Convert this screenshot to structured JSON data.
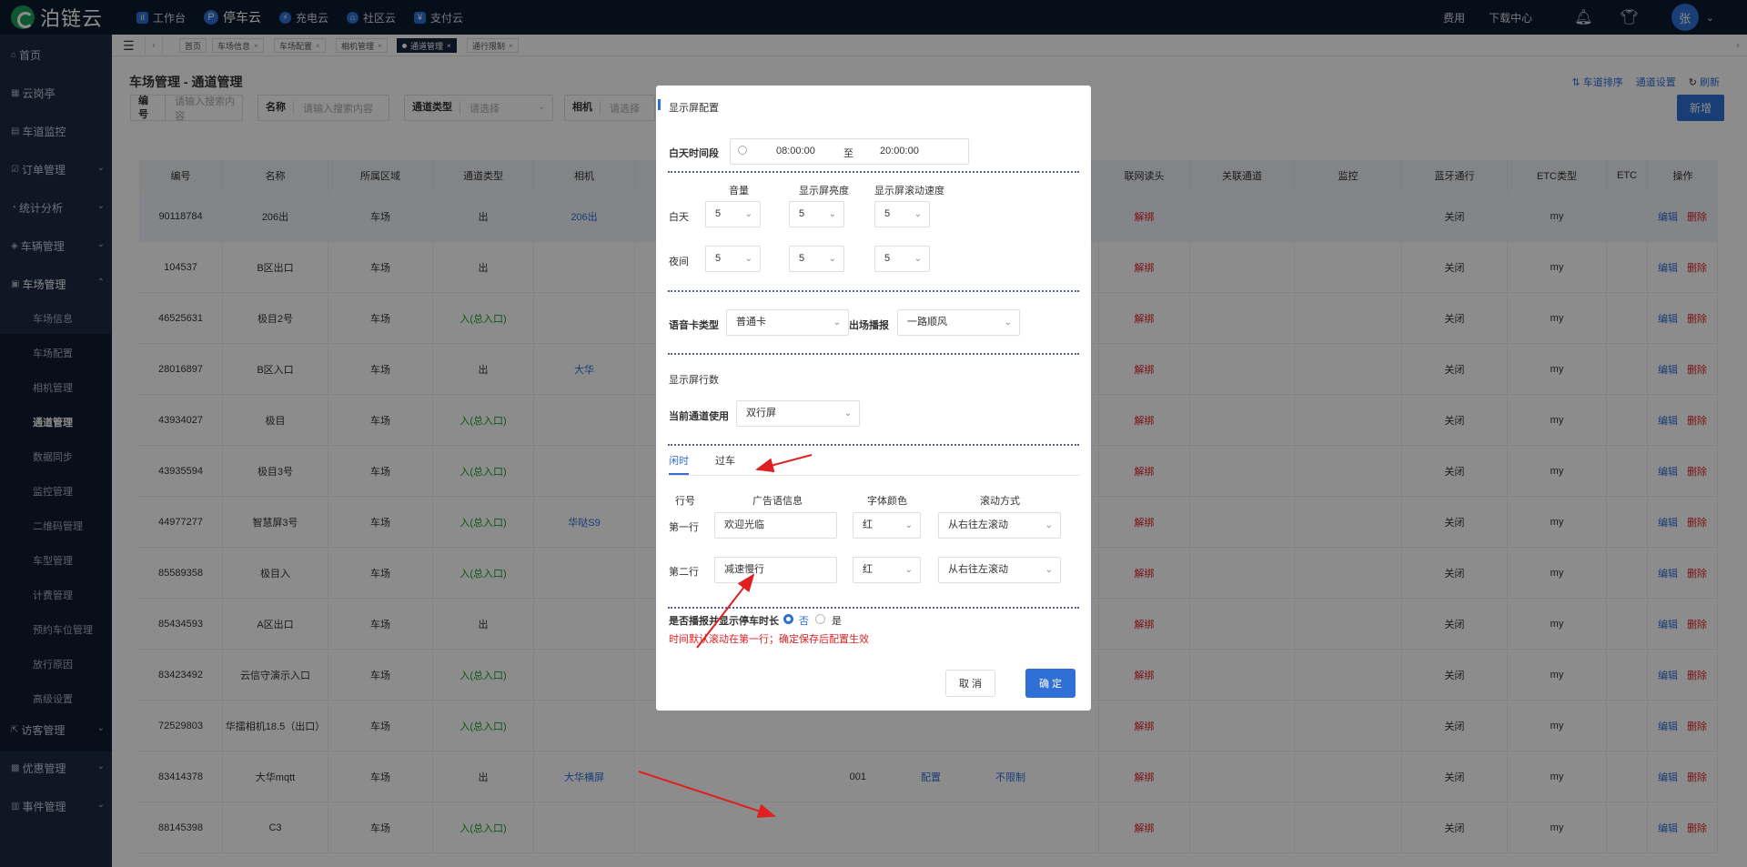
{
  "topbar": {
    "logo_text": "泊链云",
    "nav": [
      {
        "label": "工作台",
        "icon": "dashboard-icon"
      },
      {
        "label": "停车云",
        "icon": "parking-icon"
      },
      {
        "label": "充电云",
        "icon": "charging-icon"
      },
      {
        "label": "社区云",
        "icon": "community-icon"
      },
      {
        "label": "支付云",
        "icon": "payment-icon"
      }
    ],
    "fees": "费用",
    "download": "下载中心",
    "avatar": "张"
  },
  "sidebar": {
    "items": [
      {
        "label": "首页"
      },
      {
        "label": "云岗亭"
      },
      {
        "label": "车道监控"
      },
      {
        "label": "订单管理"
      },
      {
        "label": "统计分析"
      },
      {
        "label": "车辆管理"
      },
      {
        "label": "车场管理"
      },
      {
        "label": "访客管理"
      },
      {
        "label": "优惠管理"
      },
      {
        "label": "事件管理"
      }
    ],
    "sub_items": [
      "车场信息",
      "车场配置",
      "相机管理",
      "通道管理",
      "数据同步",
      "监控管理",
      "二维码管理",
      "车型管理",
      "计费管理",
      "预约车位管理",
      "放行原因",
      "高级设置"
    ]
  },
  "tabs": [
    "首页",
    "车场信息",
    "车场配置",
    "相机管理",
    "通道管理",
    "通行限制"
  ],
  "page": {
    "title": "车场管理 - 通道管理",
    "links": {
      "sort": "车道排序",
      "settings": "通道设置",
      "refresh": "刷新"
    },
    "filters": [
      {
        "label": "编号",
        "placeholder": "请输入搜索内容"
      },
      {
        "label": "名称",
        "placeholder": "请输入搜索内容"
      },
      {
        "label": "通道类型",
        "placeholder": "请选择"
      },
      {
        "label": "相机",
        "placeholder": "请选择"
      }
    ],
    "new_button": "新增"
  },
  "table": {
    "headers": [
      "编号",
      "名称",
      "所属区域",
      "通道类型",
      "相机",
      "联网读头",
      "关联通道",
      "监控",
      "蓝牙通行",
      "ETC类型",
      "ETC",
      "操作"
    ],
    "rows": [
      {
        "id": "90118784",
        "name": "206出",
        "area": "车场",
        "type": "出",
        "camera": "206出",
        "unbind": "解绑",
        "bt": "关闭",
        "etc": "my"
      },
      {
        "id": "104537",
        "name": "B区出口",
        "area": "车场",
        "type": "出",
        "camera": "",
        "unbind": "解绑",
        "bt": "关闭",
        "etc": "my"
      },
      {
        "id": "46525631",
        "name": "极目2号",
        "area": "车场",
        "type": "入(总入口)",
        "camera": "",
        "unbind": "解绑",
        "bt": "关闭",
        "etc": "my"
      },
      {
        "id": "28016897",
        "name": "B区入口",
        "area": "车场",
        "type": "出",
        "camera": "大华",
        "unbind": "解绑",
        "bt": "关闭",
        "etc": "my"
      },
      {
        "id": "43934027",
        "name": "极目",
        "area": "车场",
        "type": "入(总入口)",
        "camera": "",
        "unbind": "解绑",
        "bt": "关闭",
        "etc": "my"
      },
      {
        "id": "43935594",
        "name": "极目3号",
        "area": "车场",
        "type": "入(总入口)",
        "camera": "",
        "unbind": "解绑",
        "bt": "关闭",
        "etc": "my"
      },
      {
        "id": "44977277",
        "name": "智慧屏3号",
        "area": "车场",
        "type": "入(总入口)",
        "camera": "华哒S9",
        "unbind": "解绑",
        "bt": "关闭",
        "etc": "my"
      },
      {
        "id": "85589358",
        "name": "极目入",
        "area": "车场",
        "type": "入(总入口)",
        "camera": "",
        "unbind": "解绑",
        "bt": "关闭",
        "etc": "my"
      },
      {
        "id": "85434593",
        "name": "A区出口",
        "area": "车场",
        "type": "出",
        "camera": "",
        "unbind": "解绑",
        "bt": "关闭",
        "etc": "my"
      },
      {
        "id": "83423492",
        "name": "云信守演示入口",
        "area": "车场",
        "type": "入(总入口)",
        "camera": "",
        "unbind": "解绑",
        "bt": "关闭",
        "etc": "my"
      },
      {
        "id": "72529803",
        "name": "华擂相机18.5（出口）",
        "area": "车场",
        "type": "入(总入口)",
        "camera": "",
        "unbind": "解绑",
        "bt": "关闭",
        "etc": "my"
      },
      {
        "id": "83414378",
        "name": "大华mqtt",
        "area": "车场",
        "type": "出",
        "camera": "大华横屏",
        "unbind": "解绑",
        "bt": "关闭",
        "etc": "my"
      },
      {
        "id": "88145398",
        "name": "C3",
        "area": "车场",
        "type": "入(总入口)",
        "camera": "",
        "unbind": "解绑",
        "bt": "关闭",
        "etc": "my"
      }
    ],
    "row12_extra": {
      "code": "001",
      "config": "配置",
      "limit": "不限制"
    },
    "op_edit": "编辑",
    "op_delete": "删除",
    "op_config": "配置",
    "op_unbind": "解绑"
  },
  "modal": {
    "title": "显示屏配置",
    "day_period_label": "白天时间段",
    "time_start": "08:00:00",
    "time_to": "至",
    "time_end": "20:00:00",
    "col_volume": "音量",
    "col_brightness": "显示屏亮度",
    "col_speed": "显示屏滚动速度",
    "day_label": "白天",
    "night_label": "夜间",
    "day_values": [
      "5",
      "5",
      "5"
    ],
    "night_values": [
      "5",
      "5",
      "5"
    ],
    "voice_card_label": "语音卡类型",
    "voice_card_value": "普通卡",
    "exit_broadcast_label": "出场播报",
    "exit_broadcast_value": "一路顺风",
    "display_lines_label": "显示屏行数",
    "current_lane_label": "当前通道使用",
    "current_lane_value": "双行屏",
    "tab_idle": "闲时",
    "tab_pass": "过车",
    "h_line": "行号",
    "h_ad": "广告语信息",
    "h_color": "字体颜色",
    "h_scroll": "滚动方式",
    "line1_label": "第一行",
    "line1_ad": "欢迎光临",
    "line1_color": "红",
    "line1_scroll": "从右往左滚动",
    "line2_label": "第二行",
    "line2_ad": "减速慢行",
    "line2_color": "红",
    "line2_scroll": "从右往左滚动",
    "broadcast_q": "是否播报并显示停车时长",
    "opt_no": "否",
    "opt_yes": "是",
    "warning": "时间默认滚动在第一行；确定保存后配置生效",
    "cancel": "取 消",
    "ok": "确 定"
  },
  "colors": {
    "accent": "#2f6fd6",
    "danger": "#e02020",
    "topbar": "#0b1a2f",
    "sidebar": "#1b2a41"
  }
}
